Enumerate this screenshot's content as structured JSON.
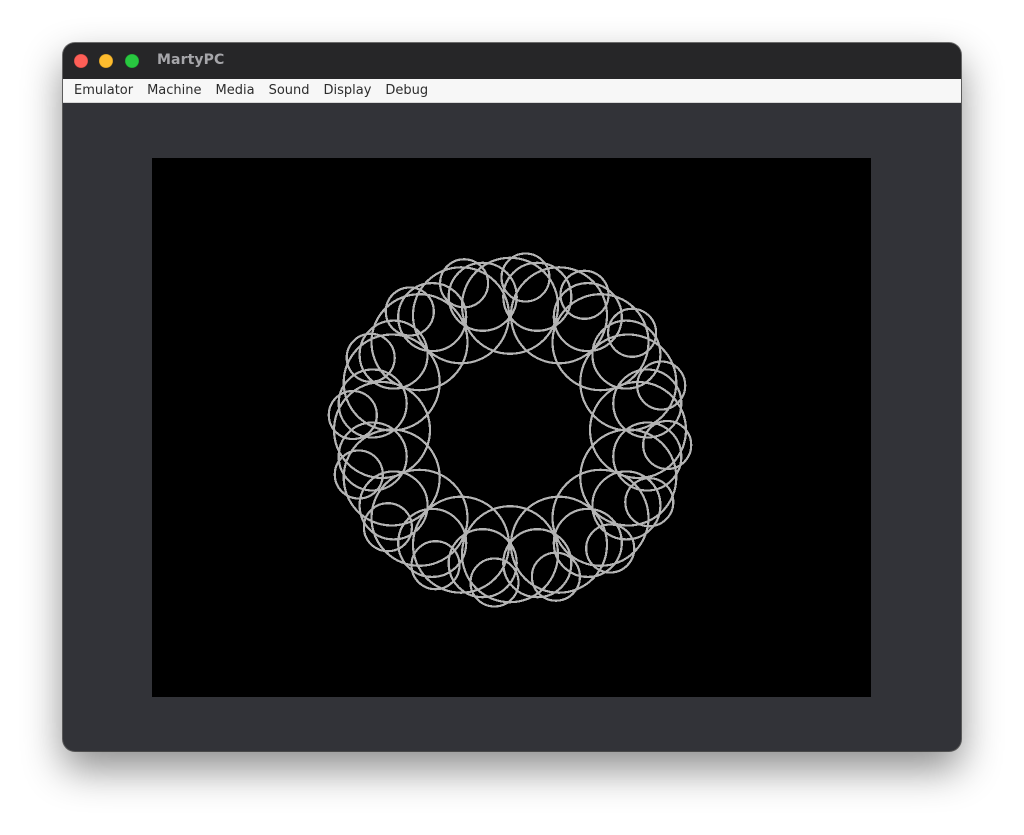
{
  "window": {
    "title": "MartyPC"
  },
  "titlebar": {
    "buttons": [
      {
        "name": "close",
        "color": "#fe5f57"
      },
      {
        "name": "minimize",
        "color": "#febc2e"
      },
      {
        "name": "maximize",
        "color": "#28c840"
      }
    ]
  },
  "menubar": {
    "items": [
      "Emulator",
      "Machine",
      "Media",
      "Sound",
      "Display",
      "Debug"
    ]
  },
  "display": {
    "background": "#000000",
    "pattern": {
      "color": "#b4b4b4",
      "circle_count": 16
    }
  }
}
